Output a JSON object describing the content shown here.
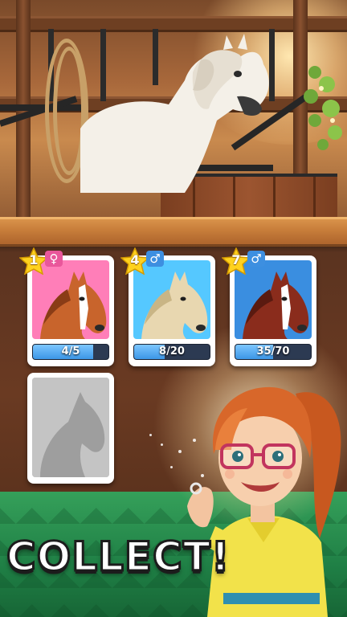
{
  "cards": [
    {
      "level": "1",
      "gender_symbol": "♀",
      "gender_color": "#e9579b",
      "bg": "#ff7eb8",
      "coat": "#c8642c",
      "mane": "#8a3c16",
      "blaze": true,
      "progress_text": "4/5",
      "progress": 0.8
    },
    {
      "level": "4",
      "gender_symbol": "♂",
      "gender_color": "#3d8fe0",
      "bg": "#55c8ff",
      "coat": "#e8d7b0",
      "mane": "#c9b585",
      "blaze": false,
      "progress_text": "8/20",
      "progress": 0.4
    },
    {
      "level": "7",
      "gender_symbol": "♂",
      "gender_color": "#3d8fe0",
      "bg": "#3a8ee0",
      "coat": "#8a2c1c",
      "mane": "#5a1a10",
      "blaze": true,
      "progress_text": "35/70",
      "progress": 0.5
    }
  ],
  "locked_card": {
    "state": "locked",
    "silhouette_color": "#9e9e9e"
  },
  "banner": {
    "text": "COLLECT!"
  },
  "colors": {
    "star": "#ffd21f",
    "progress_fill": "#4aa3f0",
    "floor": "#2a9150"
  }
}
